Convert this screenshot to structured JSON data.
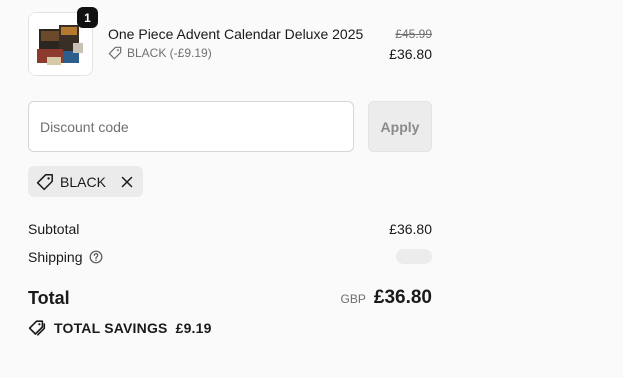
{
  "line_item": {
    "quantity": "1",
    "title": "One Piece Advent Calendar Deluxe 2025",
    "discount_label": "BLACK (-£9.19)",
    "original_price": "£45.99",
    "price": "£36.80"
  },
  "discount": {
    "placeholder": "Discount code",
    "apply_label": "Apply",
    "applied_code": "BLACK"
  },
  "summary": {
    "subtotal_label": "Subtotal",
    "subtotal_value": "£36.80",
    "shipping_label": "Shipping",
    "total_label": "Total",
    "currency": "GBP",
    "total_value": "£36.80",
    "savings_label": "TOTAL SAVINGS",
    "savings_value": "£9.19"
  },
  "icons": {
    "tag": "tag-icon",
    "close": "close-icon",
    "help": "question-circle-icon",
    "savings": "tags-icon"
  }
}
